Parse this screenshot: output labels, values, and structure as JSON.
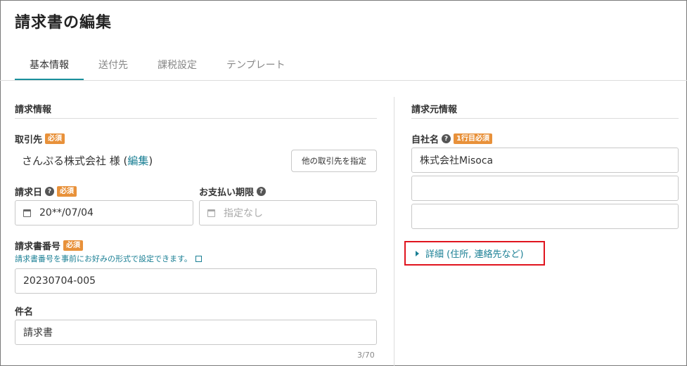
{
  "page": {
    "title": "請求書の編集"
  },
  "tabs": [
    {
      "label": "基本情報",
      "active": true
    },
    {
      "label": "送付先",
      "active": false
    },
    {
      "label": "課税設定",
      "active": false
    },
    {
      "label": "テンプレート",
      "active": false
    }
  ],
  "invoice_info": {
    "heading": "請求情報",
    "client": {
      "label": "取引先",
      "badge": "必須",
      "name": "さんぷる株式会社 様 (",
      "edit_link": "編集",
      "close_paren": ")",
      "change_button": "他の取引先を指定"
    },
    "issue_date": {
      "label": "請求日",
      "badge": "必須",
      "value": "20**/07/04"
    },
    "due_date": {
      "label": "お支払い期限",
      "placeholder": "指定なし"
    },
    "invoice_number": {
      "label": "請求書番号",
      "badge": "必須",
      "hint": "請求書番号を事前にお好みの形式で設定できます。",
      "value": "20230704-005"
    },
    "subject": {
      "label": "件名",
      "value": "請求書",
      "counter": "3/70"
    }
  },
  "issuer_info": {
    "heading": "請求元情報",
    "company": {
      "label": "自社名",
      "badge": "1行目必須",
      "line1": "株式会社Misoca",
      "line2": "",
      "line3": ""
    },
    "details_toggle": "詳細 (住所, 連絡先など)"
  },
  "colors": {
    "accent": "#1a8f9c",
    "link": "#1a7f94",
    "badge": "#e8913a",
    "highlight": "#e0141e"
  },
  "icons": [
    "help-icon",
    "calendar-icon",
    "external-link-icon",
    "caret-right-icon"
  ]
}
